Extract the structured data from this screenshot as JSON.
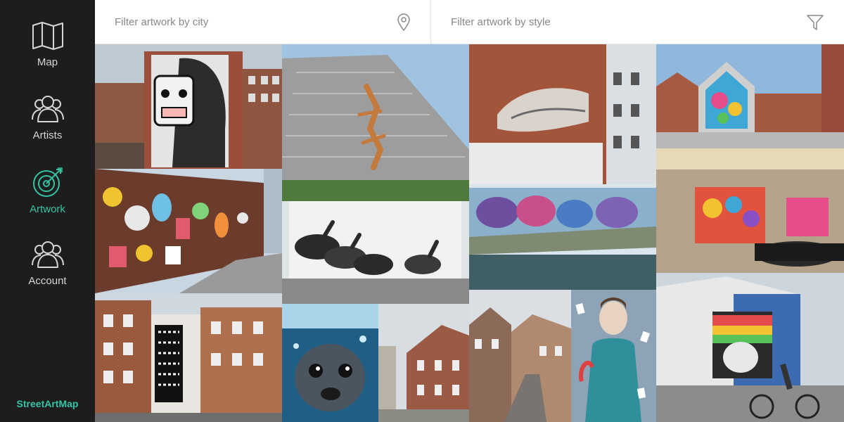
{
  "sidebar": {
    "items": [
      {
        "label": "Map",
        "icon": "map-icon"
      },
      {
        "label": "Artists",
        "icon": "users-icon"
      },
      {
        "label": "Artwork",
        "icon": "target-icon",
        "active": true
      },
      {
        "label": "Account",
        "icon": "users-icon"
      }
    ],
    "brand": "StreetArtMap"
  },
  "filters": {
    "city_placeholder": "Filter artwork by city",
    "style_placeholder": "Filter artwork by style"
  },
  "colors": {
    "sidebar_bg": "#1d1d1d",
    "accent": "#35c3a3",
    "nav_text": "#d6d6d6"
  },
  "artworks": [
    {
      "name": "mural-masked-woman",
      "subject": "masked woman mural"
    },
    {
      "name": "mural-lizard-roof",
      "subject": "lizard on roof"
    },
    {
      "name": "mural-reclining-figure",
      "subject": "reclining figure"
    },
    {
      "name": "mural-colorful-gable",
      "subject": "colorful gable"
    },
    {
      "name": "mural-cartoon-wall",
      "subject": "cartoon wall"
    },
    {
      "name": "mural-rabbits",
      "subject": "rabbits"
    },
    {
      "name": "mural-canal-graffiti",
      "subject": "canal graffiti"
    },
    {
      "name": "mural-garage-faces",
      "subject": "garage faces"
    },
    {
      "name": "mural-black-white-pattern",
      "subject": "pattern building"
    },
    {
      "name": "mural-underwater-seal",
      "subject": "underwater seal"
    },
    {
      "name": "street-photo",
      "subject": "street"
    },
    {
      "name": "mural-woman-blue-dress",
      "subject": "woman in blue dress"
    },
    {
      "name": "mural-rooster-shed",
      "subject": "rooster shed"
    }
  ]
}
